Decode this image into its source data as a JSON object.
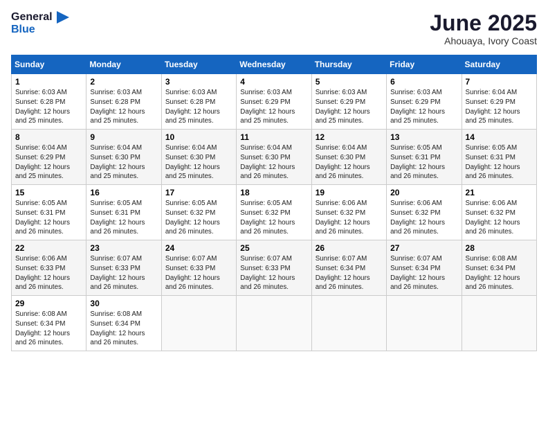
{
  "header": {
    "logo_general": "General",
    "logo_blue": "Blue",
    "title": "June 2025",
    "subtitle": "Ahouaya, Ivory Coast"
  },
  "weekdays": [
    "Sunday",
    "Monday",
    "Tuesday",
    "Wednesday",
    "Thursday",
    "Friday",
    "Saturday"
  ],
  "weeks": [
    [
      {
        "day": "1",
        "info": "Sunrise: 6:03 AM\nSunset: 6:28 PM\nDaylight: 12 hours\nand 25 minutes."
      },
      {
        "day": "2",
        "info": "Sunrise: 6:03 AM\nSunset: 6:28 PM\nDaylight: 12 hours\nand 25 minutes."
      },
      {
        "day": "3",
        "info": "Sunrise: 6:03 AM\nSunset: 6:28 PM\nDaylight: 12 hours\nand 25 minutes."
      },
      {
        "day": "4",
        "info": "Sunrise: 6:03 AM\nSunset: 6:29 PM\nDaylight: 12 hours\nand 25 minutes."
      },
      {
        "day": "5",
        "info": "Sunrise: 6:03 AM\nSunset: 6:29 PM\nDaylight: 12 hours\nand 25 minutes."
      },
      {
        "day": "6",
        "info": "Sunrise: 6:03 AM\nSunset: 6:29 PM\nDaylight: 12 hours\nand 25 minutes."
      },
      {
        "day": "7",
        "info": "Sunrise: 6:04 AM\nSunset: 6:29 PM\nDaylight: 12 hours\nand 25 minutes."
      }
    ],
    [
      {
        "day": "8",
        "info": "Sunrise: 6:04 AM\nSunset: 6:29 PM\nDaylight: 12 hours\nand 25 minutes."
      },
      {
        "day": "9",
        "info": "Sunrise: 6:04 AM\nSunset: 6:30 PM\nDaylight: 12 hours\nand 25 minutes."
      },
      {
        "day": "10",
        "info": "Sunrise: 6:04 AM\nSunset: 6:30 PM\nDaylight: 12 hours\nand 25 minutes."
      },
      {
        "day": "11",
        "info": "Sunrise: 6:04 AM\nSunset: 6:30 PM\nDaylight: 12 hours\nand 26 minutes."
      },
      {
        "day": "12",
        "info": "Sunrise: 6:04 AM\nSunset: 6:30 PM\nDaylight: 12 hours\nand 26 minutes."
      },
      {
        "day": "13",
        "info": "Sunrise: 6:05 AM\nSunset: 6:31 PM\nDaylight: 12 hours\nand 26 minutes."
      },
      {
        "day": "14",
        "info": "Sunrise: 6:05 AM\nSunset: 6:31 PM\nDaylight: 12 hours\nand 26 minutes."
      }
    ],
    [
      {
        "day": "15",
        "info": "Sunrise: 6:05 AM\nSunset: 6:31 PM\nDaylight: 12 hours\nand 26 minutes."
      },
      {
        "day": "16",
        "info": "Sunrise: 6:05 AM\nSunset: 6:31 PM\nDaylight: 12 hours\nand 26 minutes."
      },
      {
        "day": "17",
        "info": "Sunrise: 6:05 AM\nSunset: 6:32 PM\nDaylight: 12 hours\nand 26 minutes."
      },
      {
        "day": "18",
        "info": "Sunrise: 6:05 AM\nSunset: 6:32 PM\nDaylight: 12 hours\nand 26 minutes."
      },
      {
        "day": "19",
        "info": "Sunrise: 6:06 AM\nSunset: 6:32 PM\nDaylight: 12 hours\nand 26 minutes."
      },
      {
        "day": "20",
        "info": "Sunrise: 6:06 AM\nSunset: 6:32 PM\nDaylight: 12 hours\nand 26 minutes."
      },
      {
        "day": "21",
        "info": "Sunrise: 6:06 AM\nSunset: 6:32 PM\nDaylight: 12 hours\nand 26 minutes."
      }
    ],
    [
      {
        "day": "22",
        "info": "Sunrise: 6:06 AM\nSunset: 6:33 PM\nDaylight: 12 hours\nand 26 minutes."
      },
      {
        "day": "23",
        "info": "Sunrise: 6:07 AM\nSunset: 6:33 PM\nDaylight: 12 hours\nand 26 minutes."
      },
      {
        "day": "24",
        "info": "Sunrise: 6:07 AM\nSunset: 6:33 PM\nDaylight: 12 hours\nand 26 minutes."
      },
      {
        "day": "25",
        "info": "Sunrise: 6:07 AM\nSunset: 6:33 PM\nDaylight: 12 hours\nand 26 minutes."
      },
      {
        "day": "26",
        "info": "Sunrise: 6:07 AM\nSunset: 6:34 PM\nDaylight: 12 hours\nand 26 minutes."
      },
      {
        "day": "27",
        "info": "Sunrise: 6:07 AM\nSunset: 6:34 PM\nDaylight: 12 hours\nand 26 minutes."
      },
      {
        "day": "28",
        "info": "Sunrise: 6:08 AM\nSunset: 6:34 PM\nDaylight: 12 hours\nand 26 minutes."
      }
    ],
    [
      {
        "day": "29",
        "info": "Sunrise: 6:08 AM\nSunset: 6:34 PM\nDaylight: 12 hours\nand 26 minutes."
      },
      {
        "day": "30",
        "info": "Sunrise: 6:08 AM\nSunset: 6:34 PM\nDaylight: 12 hours\nand 26 minutes."
      },
      {
        "day": "",
        "info": ""
      },
      {
        "day": "",
        "info": ""
      },
      {
        "day": "",
        "info": ""
      },
      {
        "day": "",
        "info": ""
      },
      {
        "day": "",
        "info": ""
      }
    ]
  ]
}
